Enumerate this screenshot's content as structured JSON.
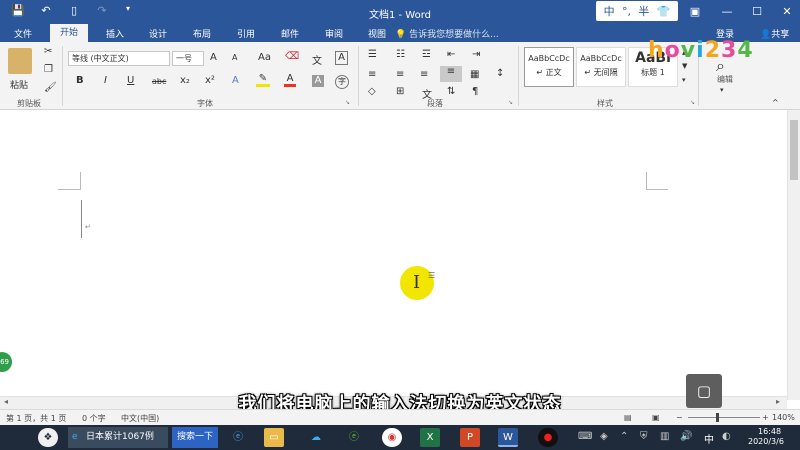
{
  "window": {
    "title": "文档1 - Word",
    "login": "登录",
    "share": "共享"
  },
  "ime": {
    "lang": "中",
    "mode": "°,",
    "width": "半"
  },
  "tabs": {
    "file": "文件",
    "home": "开始",
    "insert": "插入",
    "design": "设计",
    "layout": "布局",
    "references": "引用",
    "mailings": "邮件",
    "review": "审阅",
    "view": "视图",
    "tell_me": "告诉我您想要做什么..."
  },
  "ribbon": {
    "clipboard": {
      "paste": "粘贴",
      "label": "剪贴板"
    },
    "font": {
      "family": "等线 (中文正文)",
      "size": "一号",
      "label": "字体",
      "grow": "A",
      "shrink": "A",
      "case": "Aa",
      "bold": "B",
      "italic": "I",
      "underline": "U",
      "strike": "abc",
      "sub": "x₂",
      "sup": "x²",
      "color_a": "A",
      "box_a": "A"
    },
    "paragraph": {
      "label": "段落"
    },
    "styles": {
      "label": "样式",
      "items": [
        {
          "sample": "AaBbCcDc",
          "name": "↵ 正文"
        },
        {
          "sample": "AaBbCcDc",
          "name": "↵ 无间隔"
        },
        {
          "sample": "AaBl",
          "name": "标题 1"
        }
      ]
    },
    "editing": {
      "label": "编辑"
    }
  },
  "logo": {
    "text": "hovi234"
  },
  "document": {
    "caption": "我们将电脑上的输入法切换为英文状态",
    "side_badge": "69"
  },
  "status": {
    "page": "第 1 页，共 1 页",
    "words": "0 个字",
    "lang": "中文(中国)",
    "zoom": "140%"
  },
  "taskbar": {
    "ie_task": "日本累计1067例",
    "search": "搜索一下",
    "time": "16:48",
    "date": "2020/3/6",
    "ime": "中"
  },
  "colors": {
    "word_blue": "#2b579a",
    "ribbon_bg": "#f3f3f3",
    "highlight": "#f2e600",
    "taskbar": "#1f2b3a"
  }
}
